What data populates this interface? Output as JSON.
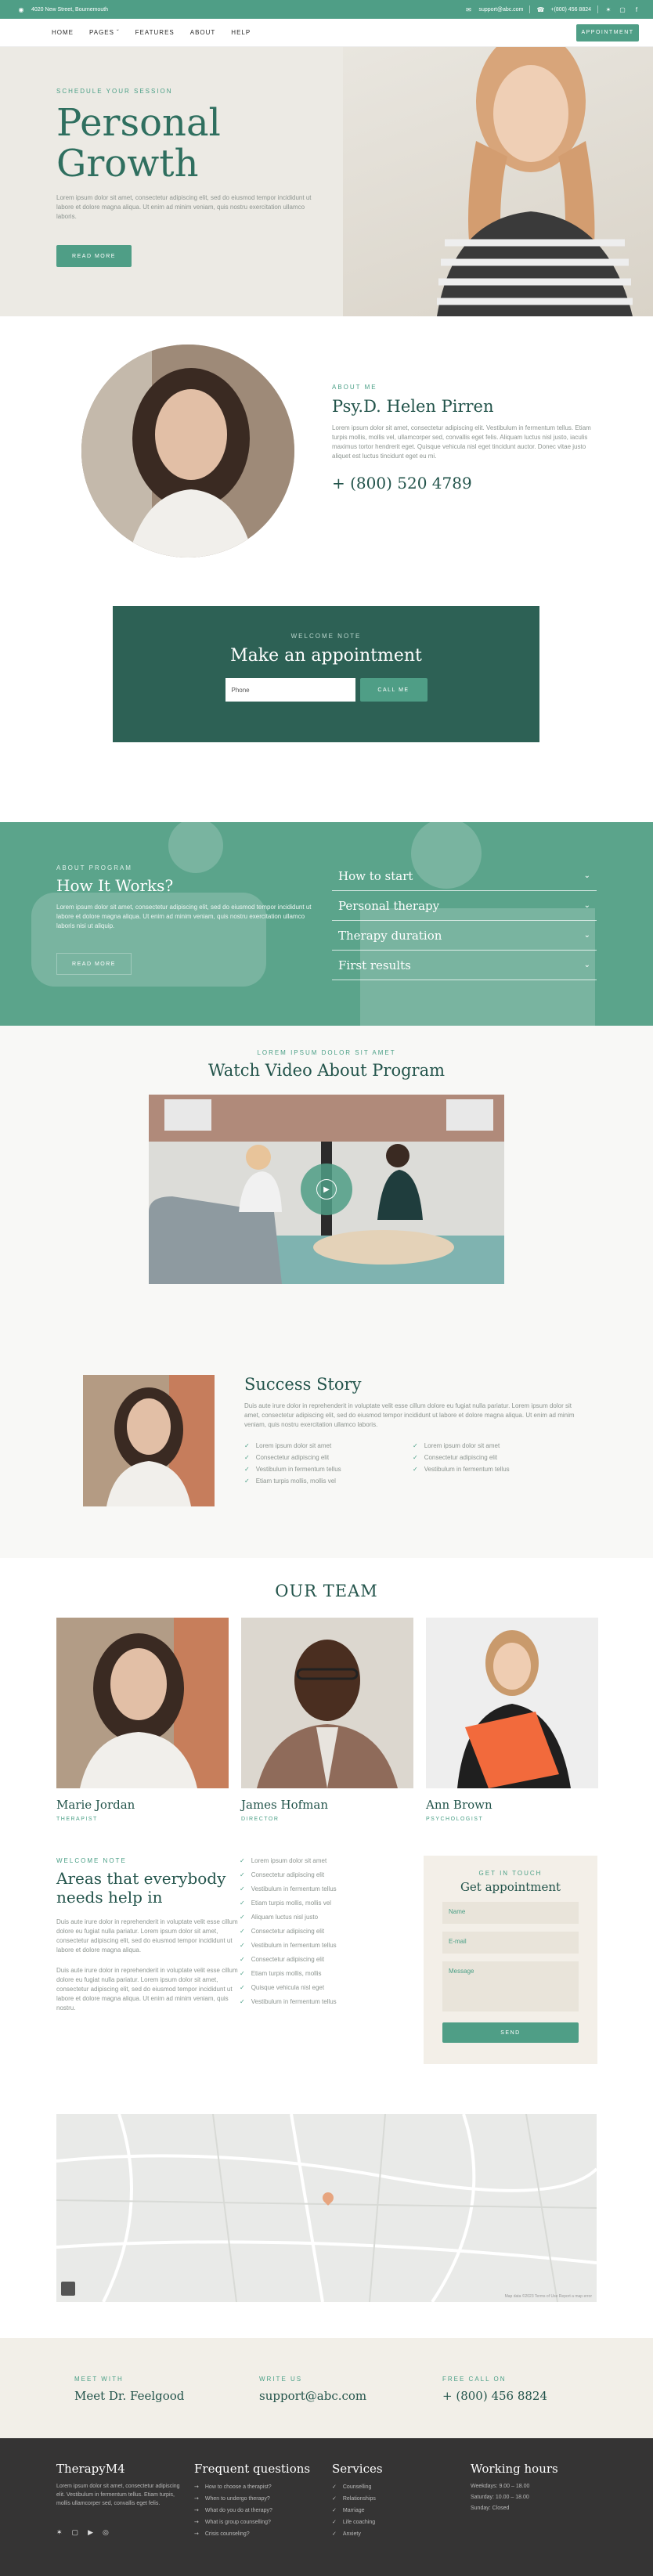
{
  "topbar": {
    "address": "4020 New Street, Bournemouth",
    "email": "support@abc.com",
    "phone": "+(800) 456 8824"
  },
  "nav": {
    "items": [
      "HOME",
      "PAGES",
      "FEATURES",
      "ABOUT",
      "HELP"
    ],
    "cta": "APPOINTMENT"
  },
  "hero": {
    "eyebrow": "SCHEDULE YOUR SESSION",
    "title_line1": "Personal",
    "title_line2": "Growth",
    "text": "Lorem ipsum dolor sit amet, consectetur adipiscing elit, sed do eiusmod tempor incididunt ut labore et dolore magna aliqua. Ut enim ad minim veniam, quis nostru exercitation ullamco laboris.",
    "button": "READ MORE"
  },
  "about": {
    "eyebrow": "ABOUT ME",
    "name": "Psy.D. Helen Pirren",
    "text": "Lorem ipsum dolor sit amet, consectetur adipiscing elit. Vestibulum in fermentum tellus. Etiam turpis mollis, mollis vel, ullamcorper sed, convallis eget felis. Aliquam luctus nisl justo, iaculis maximus tortor hendrerit eget. Quisque vehicula nisl eget tincidunt auctor. Donec vitae justo aliquet est luctus tincidunt eget eu mi.",
    "phone": "+ (800) 520 4789"
  },
  "appointment": {
    "eyebrow": "WELCOME NOTE",
    "title": "Make an appointment",
    "placeholder": "Phone",
    "button": "CALL ME"
  },
  "how": {
    "eyebrow": "ABOUT PROGRAM",
    "title": "How It Works?",
    "text": "Lorem ipsum dolor sit amet, consectetur adipiscing elit, sed do eiusmod tempor incididunt ut labore et dolore magna aliqua. Ut enim ad minim veniam, quis nostru exercitation ullamco laboris nisi ut aliquip.",
    "button": "READ MORE",
    "accordion": [
      "How to start",
      "Personal therapy",
      "Therapy duration",
      "First results"
    ]
  },
  "video": {
    "eyebrow": "LOREM IPSUM DOLOR SIT AMET",
    "title": "Watch Video About Program"
  },
  "success": {
    "title": "Success Story",
    "text": "Duis aute irure dolor in reprehenderit in voluptate velit esse cillum dolore eu fugiat nulla pariatur. Lorem ipsum dolor sit amet, consectetur adipiscing elit, sed do eiusmod tempor incididunt ut labore et dolore magna aliqua. Ut enim ad minim veniam, quis nostru exercitation ullamco laboris.",
    "checks": [
      "Lorem ipsum dolor sit amet",
      "Lorem ipsum dolor sit amet",
      "Consectetur adipiscing elit",
      "Consectetur adipiscing elit",
      "Vestibulum in fermentum tellus",
      "Vestibulum in fermentum tellus",
      "Etiam turpis mollis, mollis vel"
    ]
  },
  "team": {
    "title": "OUR TEAM",
    "members": [
      {
        "name": "Marie Jordan",
        "role": "THERAPIST"
      },
      {
        "name": "James Hofman",
        "role": "DIRECTOR"
      },
      {
        "name": "Ann Brown",
        "role": "PSYCHOLOGIST"
      }
    ]
  },
  "help": {
    "eyebrow": "WELCOME NOTE",
    "title": "Areas that everybody needs help in",
    "text1": "Duis aute irure dolor in reprehenderit in voluptate velit esse cillum dolore eu fugiat nulla pariatur. Lorem ipsum dolor sit amet, consectetur adipiscing elit, sed do eiusmod tempor incididunt ut labore et dolore magna aliqua.",
    "text2": "Duis aute irure dolor in reprehenderit in voluptate velit esse cillum dolore eu fugiat nulla pariatur. Lorem ipsum dolor sit amet, consectetur adipiscing elit, sed do eiusmod tempor incididunt ut labore et dolore magna aliqua. Ut enim ad minim veniam, quis nostru.",
    "list": [
      "Lorem ipsum dolor sit amet",
      "Consectetur adipiscing elit",
      "Vestibulum in fermentum tellus",
      "Etiam turpis mollis, mollis vel",
      "Aliquam luctus nisl justo",
      "Consectetur adipiscing elit",
      "Vestibulum in fermentum tellus",
      "Consectetur adipiscing elit",
      "Etiam turpis mollis, mollis",
      "Quisque vehicula nisl eget",
      "Vestibulum in fermentum tellus"
    ]
  },
  "form": {
    "eyebrow": "GET IN TOUCH",
    "title": "Get appointment",
    "name": "Name",
    "email": "E-mail",
    "message": "Message",
    "button": "SEND"
  },
  "map": {
    "credits": "Map data ©2023   Terms of Use   Report a map error"
  },
  "contact": [
    {
      "label": "MEET WITH",
      "value": "Meet Dr. Feelgood"
    },
    {
      "label": "WRITE US",
      "value": "support@abc.com"
    },
    {
      "label": "FREE CALL ON",
      "value": "+ (800) 456 8824"
    }
  ],
  "footer": {
    "brand": "TherapyM4",
    "brand_text": "Lorem ipsum dolor sit amet, consectetur adipiscing elit. Vestibulum in fermentum tellus. Etiam turpis, mollis ullamcorper sed, convallis eget felis.",
    "faq_title": "Frequent questions",
    "faq": [
      "How to choose a therapist?",
      "When to undergo therapy?",
      "What do you do at therapy?",
      "What is group counselling?",
      "Crisis counseling?"
    ],
    "services_title": "Services",
    "services": [
      "Counselling",
      "Relationships",
      "Marriage",
      "Life coaching",
      "Anxiety"
    ],
    "hours_title": "Working hours",
    "hours": [
      "Weekdays: 9.00 – 18.00",
      "Saturday: 10.00 – 18.00",
      "Sunday: Closed"
    ]
  }
}
